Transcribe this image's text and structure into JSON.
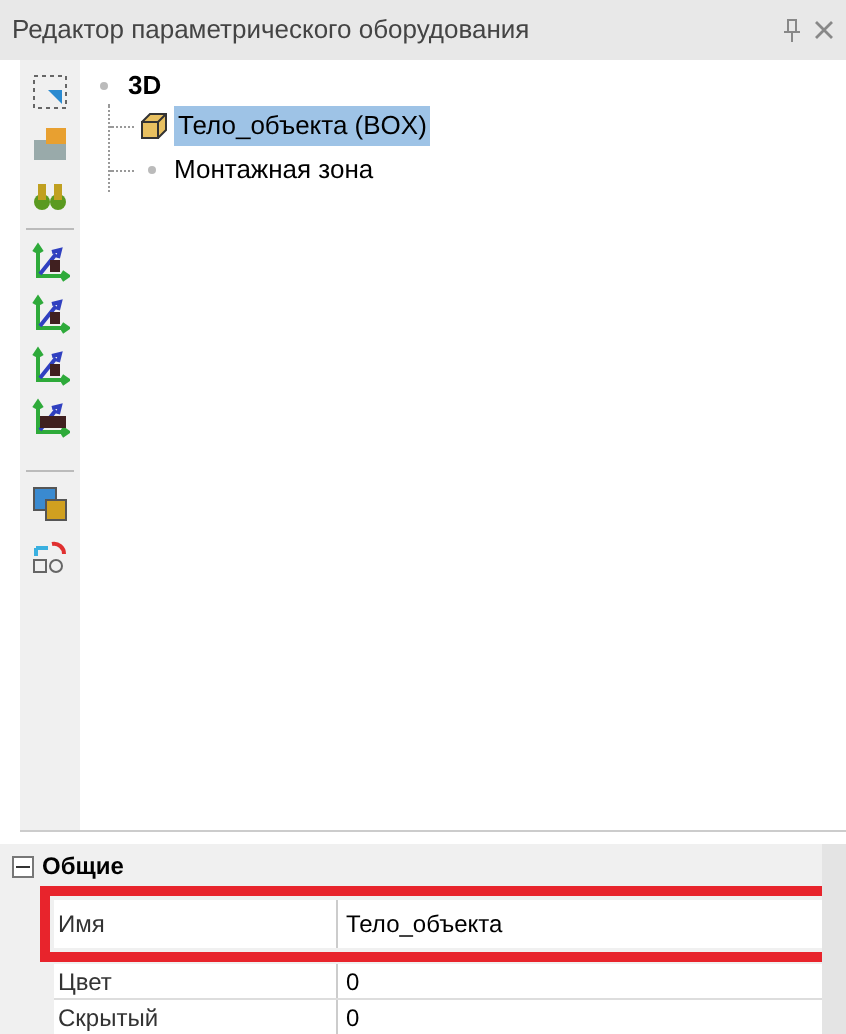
{
  "panel": {
    "title": "Редактор параметрического оборудования"
  },
  "tree": {
    "label": "3D",
    "selected": false,
    "children": [
      {
        "label": "Тело_объекта (BOX)",
        "kind": "box",
        "selected": true
      },
      {
        "label": "Монтажная зона",
        "kind": "node",
        "selected": false
      }
    ]
  },
  "properties": {
    "category": "Общие",
    "expanded": true,
    "rows": [
      {
        "name": "Имя",
        "value": "Тело_объекта",
        "highlighted": true
      },
      {
        "name": "Цвет",
        "value": "0",
        "highlighted": false
      },
      {
        "name": "Скрытый",
        "value": "0",
        "highlighted": false
      }
    ]
  }
}
